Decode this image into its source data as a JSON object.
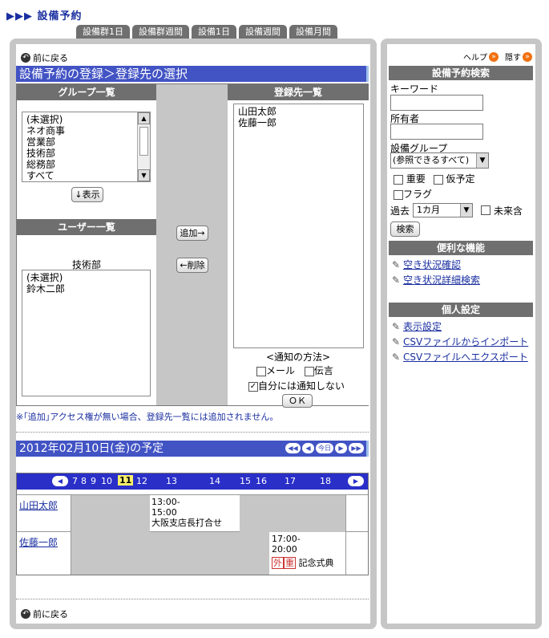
{
  "app": {
    "title": "▶▶▶ 設備予約"
  },
  "tabs": [
    "設備群1日",
    "設備群週間",
    "設備1日",
    "設備週間",
    "設備月間"
  ],
  "main": {
    "back": "前に戻る",
    "heading": "設備予約の登録＞登録先の選択",
    "group_list": {
      "header": "グループ一覧",
      "items": [
        "(未選択)",
        "ネオ商事",
        "営業部",
        "技術部",
        "総務部",
        "すべて"
      ],
      "show_btn": "↓表示"
    },
    "user_list": {
      "header": "ユーザー一覧",
      "group_name": "技術部",
      "items": [
        "(未選択)",
        "鈴木二郎"
      ]
    },
    "add_btn": "追加→",
    "remove_btn": "←削除",
    "target_list": {
      "header": "登録先一覧",
      "items": [
        "山田太郎",
        "佐藤一郎"
      ]
    },
    "notify": {
      "title": "<通知の方法>",
      "mail": "メール",
      "message": "伝言",
      "self": "自分には通知しない",
      "self_checked": true,
      "ok": "ＯＫ"
    },
    "note": "※｢追加｣アクセス権が無い場合、登録先一覧には追加されません。",
    "schedule_title": "2012年02月10日(金)の予定",
    "today_btn": "今日",
    "hours": [
      "7",
      "8",
      "9",
      "10",
      "11",
      "12",
      "13",
      "14",
      "15",
      "16",
      "17",
      "18"
    ],
    "highlight_hour": "11",
    "rows": [
      {
        "name": "山田太郎",
        "event": "13:00-\n15:00\n大阪支店長打合せ"
      },
      {
        "name": "佐藤一郎",
        "event": "17:00-\n20:00",
        "tag1": "外",
        "tag2": "重",
        "event_name": "記念式典"
      }
    ],
    "back2": "前に戻る"
  },
  "side": {
    "help": "ヘルプ",
    "hide": "隠す",
    "search_header": "設備予約検索",
    "keyword_label": "キーワード",
    "owner_label": "所有者",
    "group_label": "設備グループ",
    "group_value": "(参照できるすべて)",
    "important": "重要",
    "tentative": "仮予定",
    "flag": "フラグ",
    "past_label": "過去",
    "past_value": "1カ月",
    "future": "未来含",
    "search_btn": "検索",
    "useful_header": "便利な機能",
    "useful_links": [
      "空き状況確認",
      "空き状況詳細検索"
    ],
    "personal_header": "個人設定",
    "personal_links": [
      "表示設定",
      "CSVファイルからインポート",
      "CSVファイルへエクスポート"
    ]
  }
}
